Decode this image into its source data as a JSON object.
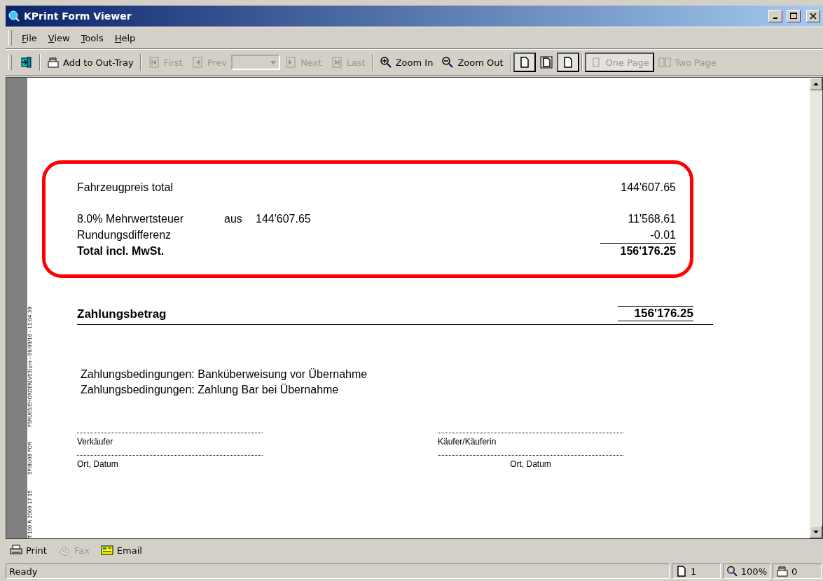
{
  "window": {
    "title": "KPrint Form Viewer"
  },
  "menu": [
    "File",
    "View",
    "Tools",
    "Help"
  ],
  "toolbar": [
    {
      "kind": "icon"
    },
    {
      "kind": "sep"
    },
    {
      "kind": "button",
      "label": "Add to Out-Tray",
      "disabled": false
    },
    {
      "kind": "sep"
    },
    {
      "kind": "button",
      "label": "First",
      "disabled": true
    },
    {
      "kind": "button",
      "label": "Prev",
      "disabled": true
    },
    {
      "kind": "dropdown",
      "disabled": true
    },
    {
      "kind": "button",
      "label": "Next",
      "disabled": true
    },
    {
      "kind": "button",
      "label": "Last",
      "disabled": true
    },
    {
      "kind": "sep"
    },
    {
      "kind": "button",
      "label": "Zoom In",
      "disabled": false
    },
    {
      "kind": "button",
      "label": "Zoom Out",
      "disabled": false
    },
    {
      "kind": "sep"
    },
    {
      "kind": "toggle",
      "selected": true
    },
    {
      "kind": "toggle",
      "selected": false
    },
    {
      "kind": "toggle",
      "selected": true
    },
    {
      "kind": "sep"
    },
    {
      "kind": "button",
      "label": "One Page",
      "disabled": true,
      "selected": true
    },
    {
      "kind": "button",
      "label": "Two Page",
      "disabled": true,
      "selected": false
    }
  ],
  "document": {
    "side_text": [
      "T:100 R 2000 17 15",
      "SP/BU08 POR",
      "FSRU05/EHORDER[V03]pm - 06/09/10 - 11:04:39"
    ],
    "summary": [
      {
        "kind": "line",
        "label": "Fahrzeugpreis total",
        "value": "144'607.65",
        "bold": false,
        "ruled": false
      },
      {
        "kind": "spacer"
      },
      {
        "kind": "line",
        "label": "8.0% Mehrwertsteuer",
        "extra": "aus",
        "base": "144'607.65",
        "value": "11'568.61",
        "bold": false,
        "ruled": false
      },
      {
        "kind": "line",
        "label": "Rundungsdifferenz",
        "value": "-0.01",
        "bold": false,
        "ruled": false
      },
      {
        "kind": "line",
        "label": "Total incl. MwSt.",
        "value": "156'176.25",
        "bold": true,
        "ruled": true
      }
    ],
    "payment": {
      "label": "Zahlungsbetrag",
      "value": "156'176.25"
    },
    "conditions": [
      "Zahlungsbedingungen: Banküberweisung vor Übernahme",
      "Zahlungsbedingungen: Zahlung Bar bei Übernahme"
    ],
    "signatures": [
      {
        "left": "Verkäufer",
        "right": "Käufer/Käuferin"
      },
      {
        "left": "Ort, Datum",
        "right": "Ort, Datum"
      }
    ]
  },
  "bottom_toolbar": [
    {
      "label": "Print",
      "disabled": false
    },
    {
      "label": "Fax",
      "disabled": true
    },
    {
      "label": "Email",
      "disabled": false
    }
  ],
  "status_bar": {
    "text": "Ready",
    "page": "1",
    "zoom": "100%",
    "tray": "0"
  }
}
